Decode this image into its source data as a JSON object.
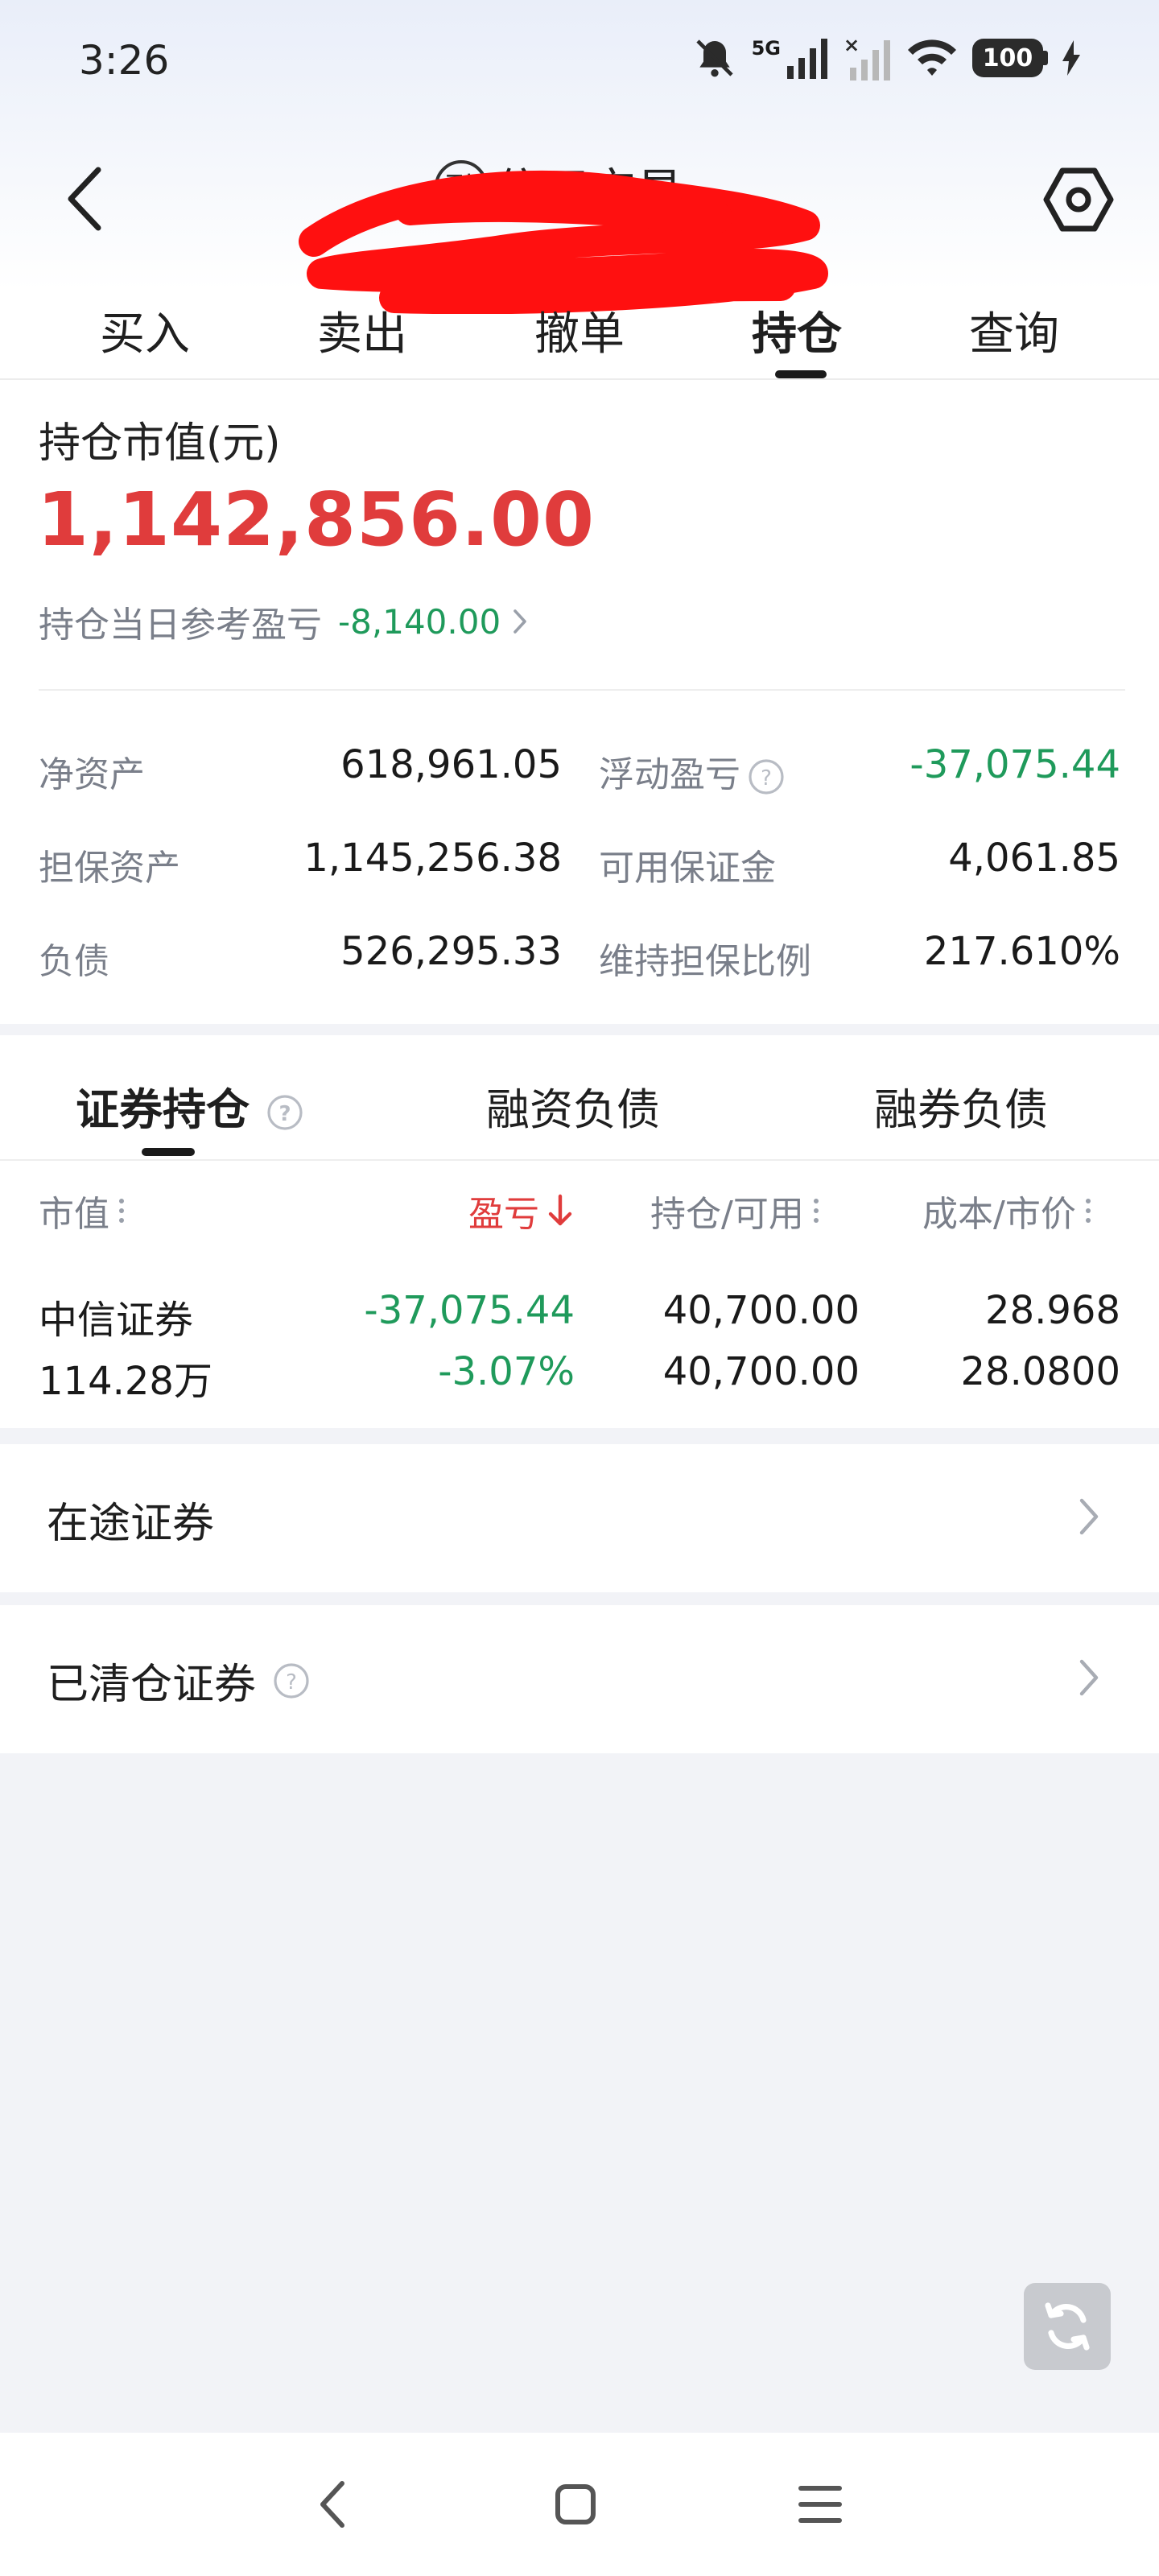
{
  "status_bar": {
    "time": "3:26",
    "network": "5G",
    "battery": "100"
  },
  "header": {
    "title": "信用交易",
    "badge": "融"
  },
  "tabs": [
    {
      "label": "买入",
      "active": false
    },
    {
      "label": "卖出",
      "active": false
    },
    {
      "label": "撤单",
      "active": false
    },
    {
      "label": "持仓",
      "active": true
    },
    {
      "label": "查询",
      "active": false
    }
  ],
  "summary": {
    "market_value_label": "持仓市值(元)",
    "market_value": "1,142,856.00",
    "daily_pl_label": "持仓当日参考盈亏",
    "daily_pl_value": "-8,140.00",
    "metrics": [
      {
        "left_label": "净资产",
        "left_value": "618,961.05",
        "right_label": "浮动盈亏",
        "right_value": "-37,075.44",
        "right_has_help": true,
        "right_green": true
      },
      {
        "left_label": "担保资产",
        "left_value": "1,145,256.38",
        "right_label": "可用保证金",
        "right_value": "4,061.85",
        "right_has_help": false,
        "right_green": false
      },
      {
        "left_label": "负债",
        "left_value": "526,295.33",
        "right_label": "维持担保比例",
        "right_value": "217.610%",
        "right_has_help": false,
        "right_green": false
      }
    ]
  },
  "holdings": {
    "sub_tabs": [
      {
        "label": "证券持仓",
        "active": true
      },
      {
        "label": "融资负债",
        "active": false
      },
      {
        "label": "融券负债",
        "active": false
      }
    ],
    "columns": {
      "market_value": "市值",
      "pl": "盈亏",
      "position": "持仓/可用",
      "cost": "成本/市价"
    },
    "rows": [
      {
        "name": "中信证券",
        "market_value": "114.28万",
        "pl": "-37,075.44",
        "pl_pct": "-3.07%",
        "position": "40,700.00",
        "available": "40,700.00",
        "cost": "28.968",
        "price": "28.0800"
      }
    ]
  },
  "lists": {
    "in_transit": "在途证券",
    "cleared": "已清仓证券"
  },
  "colors": {
    "red": "#e03c3c",
    "green": "#1f9a5b",
    "gray": "#7a7f8a",
    "background": "#f2f3f7"
  }
}
